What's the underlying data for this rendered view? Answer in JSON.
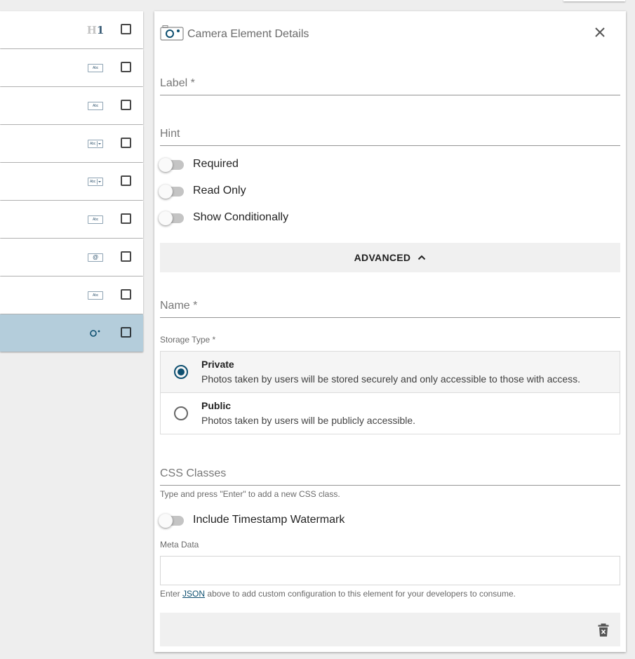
{
  "element_list": {
    "rows": [
      {
        "icon": "heading-icon",
        "icon_text": "H1",
        "selected": false
      },
      {
        "icon": "text-field-icon",
        "icon_text": "Abc",
        "selected": false
      },
      {
        "icon": "text-field-icon",
        "icon_text": "Abc",
        "selected": false
      },
      {
        "icon": "dropdown-icon",
        "icon_text": "Abc",
        "selected": false
      },
      {
        "icon": "dropdown-icon",
        "icon_text": "Abc",
        "selected": false
      },
      {
        "icon": "text-field-icon",
        "icon_text": "Abc",
        "selected": false
      },
      {
        "icon": "email-icon",
        "icon_text": "@",
        "selected": false
      },
      {
        "icon": "text-field-icon",
        "icon_text": "Abc",
        "selected": false
      },
      {
        "icon": "camera-icon",
        "icon_text": "",
        "selected": true
      }
    ],
    "selected_color": "#b4cddb"
  },
  "panel": {
    "title": "Camera Element Details",
    "label_field": {
      "label": "Label *",
      "value": ""
    },
    "hint_field": {
      "label": "Hint",
      "value": ""
    },
    "toggles": [
      {
        "label": "Required",
        "on": false
      },
      {
        "label": "Read Only",
        "on": false
      },
      {
        "label": "Show Conditionally",
        "on": false
      }
    ],
    "advanced": {
      "label": "ADVANCED",
      "expanded": true
    },
    "name_field": {
      "label": "Name *",
      "value": ""
    },
    "storage_type": {
      "label": "Storage Type *",
      "options": [
        {
          "title": "Private",
          "description": "Photos taken by users will be stored securely and only accessible to those with access.",
          "selected": true
        },
        {
          "title": "Public",
          "description": "Photos taken by users will be publicly accessible.",
          "selected": false
        }
      ]
    },
    "css_classes": {
      "label": "CSS Classes",
      "hint": "Type and press \"Enter\" to add a new CSS class."
    },
    "watermark_toggle": {
      "label": "Include Timestamp Watermark",
      "on": false
    },
    "meta_data": {
      "label": "Meta Data",
      "value": "",
      "hint_prefix": "Enter",
      "hint_link": "JSON",
      "hint_suffix": "above to add custom configuration to this element for your developers to consume."
    }
  },
  "colors": {
    "accent": "#0d4f70",
    "background": "#eeeeee"
  }
}
